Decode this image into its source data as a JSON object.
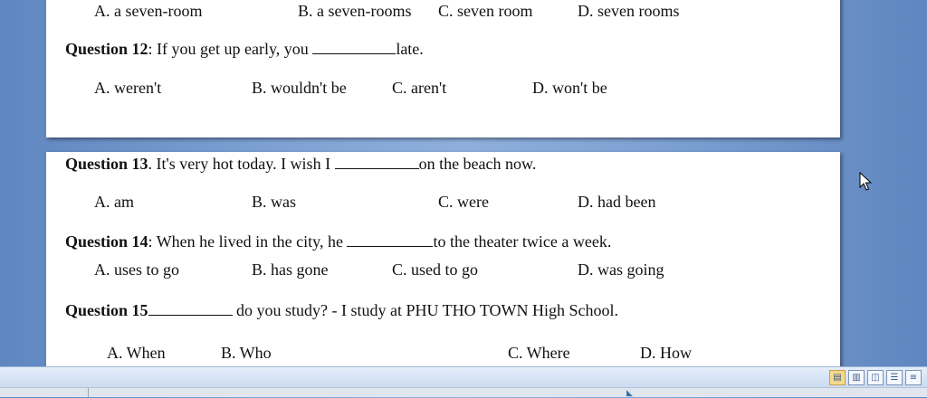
{
  "q11_options": {
    "a": "A. a seven-room",
    "b": "B. a seven-rooms",
    "c": "C. seven room",
    "d": "D. seven rooms"
  },
  "q12": {
    "label": "Question 12",
    "text_before": ": If you get up early, you ",
    "text_after": "late.",
    "a": "A. weren't",
    "b": "B. wouldn't be",
    "c": "C. aren't",
    "d": "D. won't be"
  },
  "q13": {
    "label": "Question 13",
    "text_before": ". It's very hot today. I wish I ",
    "text_after": "on the beach now.",
    "a": "A. am",
    "b": "B. was",
    "c": "C. were",
    "d": "D. had been"
  },
  "q14": {
    "label": "Question 14",
    "text_before": ":  When he lived in the city, he ",
    "text_after": "to the theater twice a week.",
    "a": "A. uses to go",
    "b": "B. has gone",
    "c": "C. used to go",
    "d": "D. was going"
  },
  "q15": {
    "label": "Question 15",
    "text_after": " do you study? - I study at PHU THO TOWN High School.",
    "a": "A. When",
    "b": "B. Who",
    "c": "C. Where",
    "d": "D. How"
  }
}
